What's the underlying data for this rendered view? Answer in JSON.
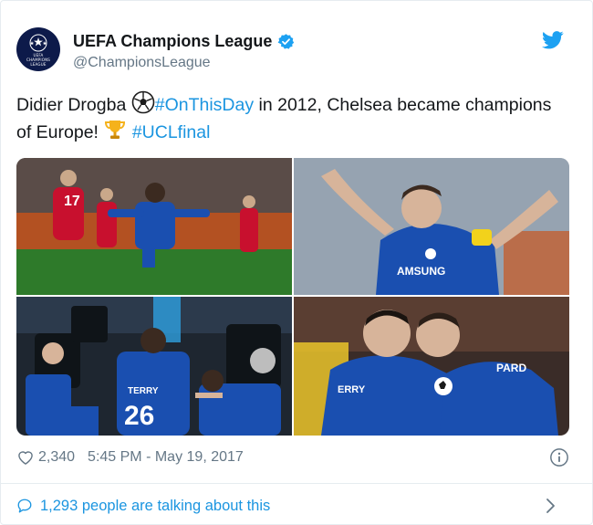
{
  "account": {
    "display_name": "UEFA Champions League",
    "handle": "@ChampionsLeague",
    "avatar_text_line1": "UEFA",
    "avatar_text_line2": "CHAMPIONS",
    "avatar_text_line3": "LEAGUE"
  },
  "tweet": {
    "text_part1": "Didier Drogba ",
    "hashtag1": "#OnThisDay",
    "text_part2": " in 2012, Chelsea became champions of Europe! ",
    "hashtag2": "#UCLfinal"
  },
  "media": {
    "photo1_number": "17",
    "photo3_name": "TERRY",
    "photo3_number": "26",
    "photo4_name_left": "ERRY",
    "photo4_name_right": "PARD",
    "photo2_sponsor": "AMSUNG"
  },
  "meta": {
    "like_count": "2,340",
    "timestamp": "5:45 PM - May 19, 2017"
  },
  "footer": {
    "talking_label": "1,293 people are talking about this"
  },
  "icons": {
    "avatar": "champions-league-starball-icon",
    "verified": "verified-badge-icon",
    "bird": "twitter-bird-icon",
    "soccer": "soccer-ball-emoji",
    "trophy": "trophy-emoji",
    "like": "heart-icon",
    "info": "info-icon",
    "talk": "speech-bubble-icon",
    "chevron": "chevron-right-icon"
  },
  "colors": {
    "link": "#1b95e0",
    "muted": "#657786",
    "text": "#14171a",
    "avatar_bg": "#0d1a4a",
    "chelsea_blue": "#1a4fb0",
    "bayern_red": "#c8102e"
  }
}
